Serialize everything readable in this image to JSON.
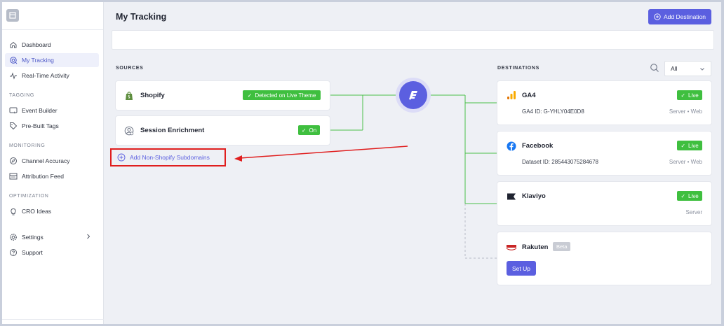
{
  "sidebar": {
    "items": [
      {
        "label": "Dashboard"
      },
      {
        "label": "My Tracking"
      },
      {
        "label": "Real-Time Activity"
      },
      {
        "label": "Event Builder"
      },
      {
        "label": "Pre-Built Tags"
      },
      {
        "label": "Channel Accuracy"
      },
      {
        "label": "Attribution Feed"
      },
      {
        "label": "CRO Ideas"
      },
      {
        "label": "Settings"
      },
      {
        "label": "Support"
      }
    ],
    "sections": {
      "tagging": "TAGGING",
      "monitoring": "MONITORING",
      "optimization": "OPTIMIZATION"
    }
  },
  "header": {
    "title": "My Tracking",
    "add_destination": "Add Destination"
  },
  "sources": {
    "label": "SOURCES",
    "shopify": {
      "name": "Shopify",
      "status": "Detected on Live Theme"
    },
    "session": {
      "name": "Session Enrichment",
      "status": "On"
    },
    "add_subdomains": "Add Non-Shopify Subdomains"
  },
  "destinations": {
    "label": "DESTINATIONS",
    "filter_value": "All",
    "ga4": {
      "name": "GA4",
      "status": "Live",
      "id_text": "GA4 ID: G-YHLY04E0D8",
      "meta": "Server • Web"
    },
    "facebook": {
      "name": "Facebook",
      "status": "Live",
      "id_text": "Dataset ID: 285443075284678",
      "meta": "Server • Web"
    },
    "klaviyo": {
      "name": "Klaviyo",
      "status": "Live",
      "meta": "Server"
    },
    "rakuten": {
      "name": "Rakuten",
      "beta": "Beta",
      "setup": "Set Up"
    }
  },
  "colors": {
    "accent": "#5b5fe0",
    "live_green": "#3fbf3f",
    "annotation_red": "#e01e1e"
  }
}
